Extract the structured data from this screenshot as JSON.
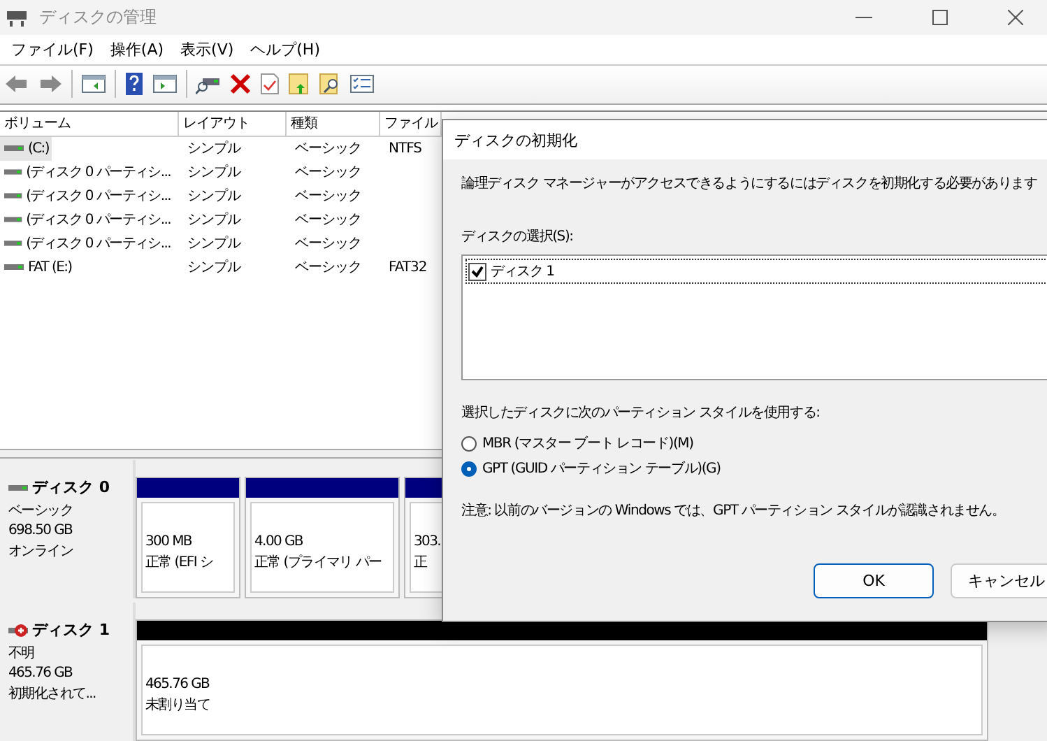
{
  "window": {
    "title": "ディスクの管理"
  },
  "menu": [
    "ファイル(F)",
    "操作(A)",
    "表示(V)",
    "ヘルプ(H)"
  ],
  "volumes": {
    "columns": [
      "ボリューム",
      "レイアウト",
      "種類",
      "ファイル"
    ],
    "rows": [
      {
        "volume": "(C:)",
        "layout": "シンプル",
        "type": "ベーシック",
        "file_system": "NTFS",
        "selected": true
      },
      {
        "volume": "(ディスク 0 パーティシ...",
        "layout": "シンプル",
        "type": "ベーシック",
        "file_system": "",
        "selected": false
      },
      {
        "volume": "(ディスク 0 パーティシ...",
        "layout": "シンプル",
        "type": "ベーシック",
        "file_system": "",
        "selected": false
      },
      {
        "volume": "(ディスク 0 パーティシ...",
        "layout": "シンプル",
        "type": "ベーシック",
        "file_system": "",
        "selected": false
      },
      {
        "volume": "(ディスク 0 パーティシ...",
        "layout": "シンプル",
        "type": "ベーシック",
        "file_system": "",
        "selected": false
      },
      {
        "volume": "FAT (E:)",
        "layout": "シンプル",
        "type": "ベーシック",
        "file_system": "FAT32",
        "selected": false
      }
    ]
  },
  "disks": [
    {
      "name": "ディスク 0",
      "kind": "online",
      "type": "ベーシック",
      "size": "698.50 GB",
      "status": "オンライン",
      "partitions": [
        {
          "kind": "primary",
          "size": "300 MB",
          "status": "正常 (EFI シ"
        },
        {
          "kind": "primary",
          "size": "4.00 GB",
          "status": "正常 (プライマリ パー"
        },
        {
          "kind": "primary",
          "size": "303.",
          "status": "正"
        }
      ]
    },
    {
      "name": "ディスク 1",
      "kind": "error",
      "type": "不明",
      "size": "465.76 GB",
      "status": "初期化されて...",
      "partitions": [
        {
          "kind": "unallocated",
          "size": "465.76 GB",
          "status": "未割り当て"
        }
      ]
    }
  ],
  "dialog": {
    "title": "ディスクの初期化",
    "message": "論理ディスク マネージャーがアクセスできるようにするにはディスクを初期化する必要があります",
    "disk_list_label": "ディスクの選択(S):",
    "disk_items": [
      {
        "label": "ディスク 1",
        "checked": true
      }
    ],
    "style_label": "選択したディスクに次のパーティション スタイルを使用する:",
    "styles": [
      {
        "label": "MBR (マスター ブート レコード)(M)",
        "selected": false
      },
      {
        "label": "GPT (GUID パーティション テーブル)(G)",
        "selected": true
      }
    ],
    "note": "注意: 以前のバージョンの Windows では、GPT パーティション スタイルが認識されません。",
    "buttons": [
      "OK",
      "キャンセル"
    ]
  }
}
